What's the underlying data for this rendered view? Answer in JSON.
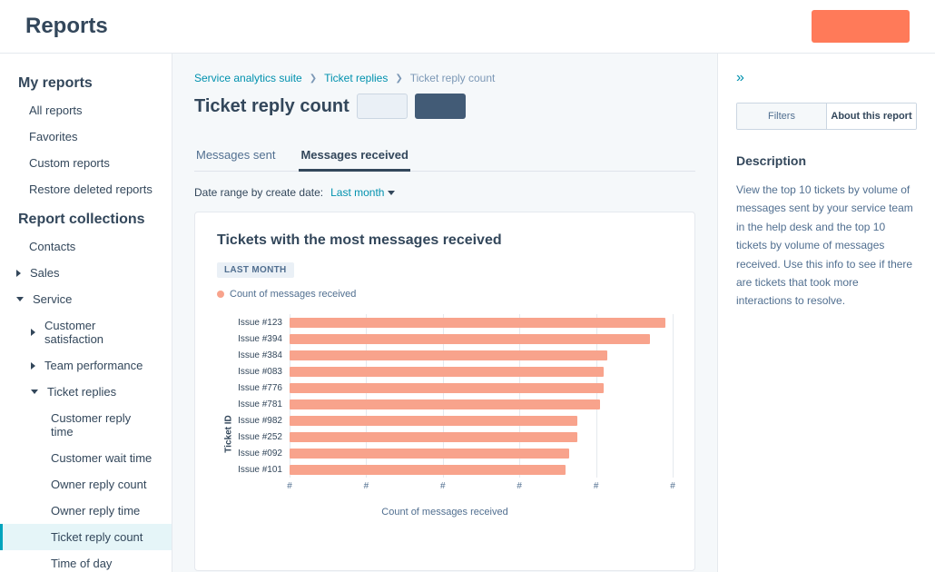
{
  "topbar": {
    "title": "Reports"
  },
  "sidebar": {
    "section1_title": "My reports",
    "section1": [
      "All reports",
      "Favorites",
      "Custom reports",
      "Restore deleted reports"
    ],
    "section2_title": "Report collections",
    "contacts": "Contacts",
    "sales": "Sales",
    "service": "Service",
    "service_children": {
      "customer_satisfaction": "Customer satisfaction",
      "team_performance": "Team performance",
      "ticket_replies": "Ticket replies",
      "ticket_replies_children": [
        "Customer reply time",
        "Customer wait time",
        "Owner reply count",
        "Owner reply time",
        "Ticket reply count",
        "Time of day"
      ]
    }
  },
  "breadcrumbs": {
    "a": "Service analytics suite",
    "b": "Ticket replies",
    "c": "Ticket reply count"
  },
  "page_title": "Ticket reply count",
  "tabs": {
    "sent": "Messages sent",
    "received": "Messages received"
  },
  "range": {
    "label": "Date range by create date:",
    "value": "Last month"
  },
  "card": {
    "title": "Tickets with the most messages received",
    "badge": "LAST MONTH",
    "legend": "Count of messages received"
  },
  "rightpane": {
    "filters": "Filters",
    "about": "About this report",
    "desc_title": "Description",
    "desc_body": "View the top 10 tickets by volume of messages sent by your service team in the help desk and the top 10 tickets by volume of messages received. Use this info to see if there are tickets that took more interactions to resolve."
  },
  "chart_data": {
    "type": "bar",
    "orientation": "horizontal",
    "title": "Tickets with the most messages received",
    "xlabel": "Count of messages received",
    "ylabel": "Ticket ID",
    "series_name": "Count of messages received",
    "xtick": "#",
    "xtick_count": 6,
    "categories": [
      "Issue #123",
      "Issue #394",
      "Issue #384",
      "Issue #083",
      "Issue #776",
      "Issue #781",
      "Issue #982",
      "Issue #252",
      "Issue #092",
      "Issue #101"
    ],
    "values": [
      98,
      94,
      83,
      82,
      82,
      81,
      75,
      75,
      73,
      72
    ],
    "xlim": [
      0,
      100
    ]
  }
}
